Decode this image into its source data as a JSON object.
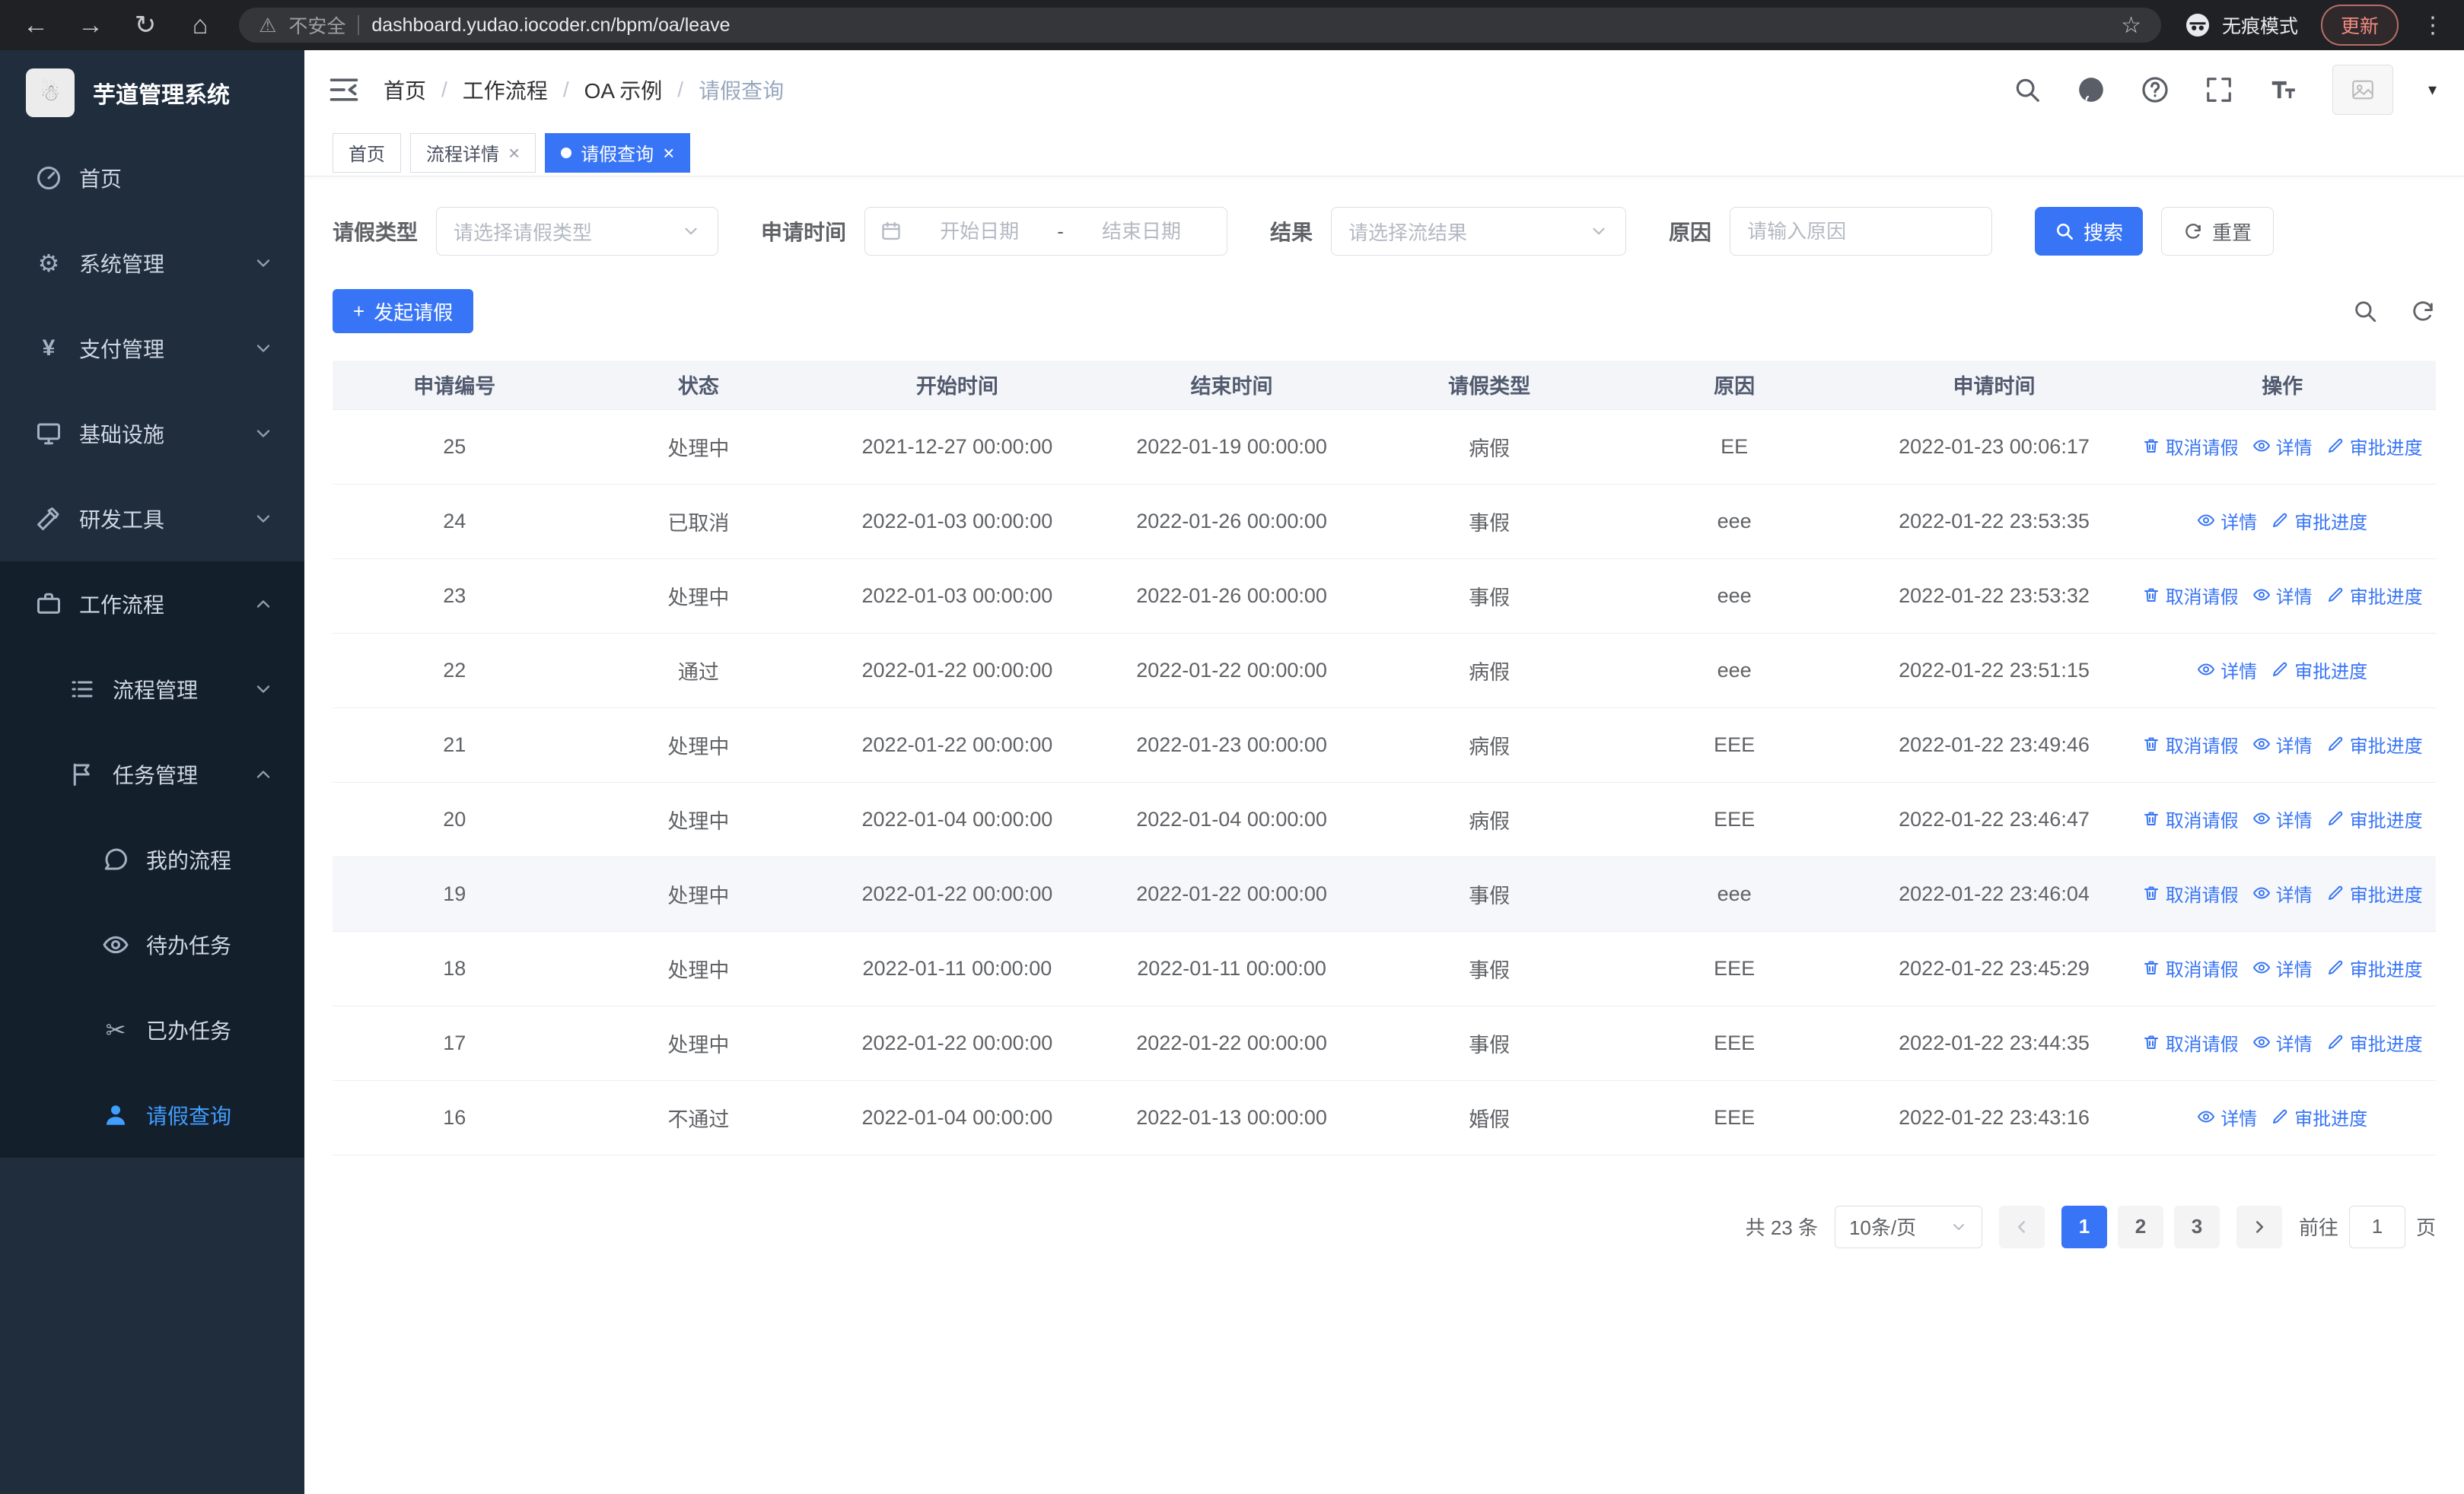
{
  "colors": {
    "accent": "#3875f6",
    "sidebar-bg": "#1f2d3d",
    "submenu-bg": "#141f2c",
    "sidebar-active": "#409eff"
  },
  "browser": {
    "security_label": "不安全",
    "url": "dashboard.yudao.iocoder.cn/bpm/oa/leave",
    "incognito_label": "无痕模式",
    "update_label": "更新"
  },
  "sidebar": {
    "logo_title": "芋道管理系统",
    "items": [
      {
        "icon": "dashboard",
        "label": "首页",
        "level": 1
      },
      {
        "icon": "gear",
        "label": "系统管理",
        "level": 1,
        "chevron": "down"
      },
      {
        "icon": "yen",
        "label": "支付管理",
        "level": 1,
        "chevron": "down"
      },
      {
        "icon": "monitor",
        "label": "基础设施",
        "level": 1,
        "chevron": "down"
      },
      {
        "icon": "hammer",
        "label": "研发工具",
        "level": 1,
        "chevron": "down"
      },
      {
        "icon": "briefcase",
        "label": "工作流程",
        "level": 1,
        "chevron": "up",
        "group": true
      },
      {
        "icon": "list",
        "label": "流程管理",
        "level": 2,
        "chevron": "down",
        "group": true
      },
      {
        "icon": "flag",
        "label": "任务管理",
        "level": 2,
        "chevron": "up",
        "group": true
      },
      {
        "icon": "chat",
        "label": "我的流程",
        "level": 3,
        "group": true
      },
      {
        "icon": "eye",
        "label": "待办任务",
        "level": 3,
        "group": true
      },
      {
        "icon": "scissors",
        "label": "已办任务",
        "level": 3,
        "group": true
      },
      {
        "icon": "person",
        "label": "请假查询",
        "level": 3,
        "group": true,
        "active": true
      }
    ]
  },
  "navbar": {
    "breadcrumb": [
      "首页",
      "工作流程",
      "OA 示例",
      "请假查询"
    ]
  },
  "tabs": [
    {
      "label": "首页",
      "closable": false,
      "active": false
    },
    {
      "label": "流程详情",
      "closable": true,
      "active": false
    },
    {
      "label": "请假查询",
      "closable": true,
      "active": true
    }
  ],
  "filters": {
    "type_label": "请假类型",
    "type_placeholder": "请选择请假类型",
    "time_label": "申请时间",
    "start_placeholder": "开始日期",
    "range_separator": "-",
    "end_placeholder": "结束日期",
    "result_label": "结果",
    "result_placeholder": "请选择流结果",
    "reason_label": "原因",
    "reason_placeholder": "请输入原因",
    "search_label": "搜索",
    "reset_label": "重置"
  },
  "toolbar": {
    "create_label": "发起请假"
  },
  "table": {
    "columns": [
      "申请编号",
      "状态",
      "开始时间",
      "结束时间",
      "请假类型",
      "原因",
      "申请时间",
      "操作"
    ],
    "action_labels": {
      "cancel": "取消请假",
      "detail": "详情",
      "progress": "审批进度"
    },
    "rows": [
      {
        "id": "25",
        "status": "处理中",
        "start": "2021-12-27 00:00:00",
        "end": "2022-01-19 00:00:00",
        "type": "病假",
        "reason": "EE",
        "apply_time": "2022-01-23 00:06:17",
        "actions": [
          "cancel",
          "detail",
          "progress"
        ]
      },
      {
        "id": "24",
        "status": "已取消",
        "start": "2022-01-03 00:00:00",
        "end": "2022-01-26 00:00:00",
        "type": "事假",
        "reason": "eee",
        "apply_time": "2022-01-22 23:53:35",
        "actions": [
          "detail",
          "progress"
        ]
      },
      {
        "id": "23",
        "status": "处理中",
        "start": "2022-01-03 00:00:00",
        "end": "2022-01-26 00:00:00",
        "type": "事假",
        "reason": "eee",
        "apply_time": "2022-01-22 23:53:32",
        "actions": [
          "cancel",
          "detail",
          "progress"
        ]
      },
      {
        "id": "22",
        "status": "通过",
        "start": "2022-01-22 00:00:00",
        "end": "2022-01-22 00:00:00",
        "type": "病假",
        "reason": "eee",
        "apply_time": "2022-01-22 23:51:15",
        "actions": [
          "detail",
          "progress"
        ]
      },
      {
        "id": "21",
        "status": "处理中",
        "start": "2022-01-22 00:00:00",
        "end": "2022-01-23 00:00:00",
        "type": "病假",
        "reason": "EEE",
        "apply_time": "2022-01-22 23:49:46",
        "actions": [
          "cancel",
          "detail",
          "progress"
        ]
      },
      {
        "id": "20",
        "status": "处理中",
        "start": "2022-01-04 00:00:00",
        "end": "2022-01-04 00:00:00",
        "type": "病假",
        "reason": "EEE",
        "apply_time": "2022-01-22 23:46:47",
        "actions": [
          "cancel",
          "detail",
          "progress"
        ]
      },
      {
        "id": "19",
        "status": "处理中",
        "start": "2022-01-22 00:00:00",
        "end": "2022-01-22 00:00:00",
        "type": "事假",
        "reason": "eee",
        "apply_time": "2022-01-22 23:46:04",
        "actions": [
          "cancel",
          "detail",
          "progress"
        ],
        "highlighted": true
      },
      {
        "id": "18",
        "status": "处理中",
        "start": "2022-01-11 00:00:00",
        "end": "2022-01-11 00:00:00",
        "type": "事假",
        "reason": "EEE",
        "apply_time": "2022-01-22 23:45:29",
        "actions": [
          "cancel",
          "detail",
          "progress"
        ]
      },
      {
        "id": "17",
        "status": "处理中",
        "start": "2022-01-22 00:00:00",
        "end": "2022-01-22 00:00:00",
        "type": "事假",
        "reason": "EEE",
        "apply_time": "2022-01-22 23:44:35",
        "actions": [
          "cancel",
          "detail",
          "progress"
        ]
      },
      {
        "id": "16",
        "status": "不通过",
        "start": "2022-01-04 00:00:00",
        "end": "2022-01-13 00:00:00",
        "type": "婚假",
        "reason": "EEE",
        "apply_time": "2022-01-22 23:43:16",
        "actions": [
          "detail",
          "progress"
        ]
      }
    ]
  },
  "pagination": {
    "total_label": "共 23 条",
    "page_size": "10条/页",
    "pages": [
      "1",
      "2",
      "3"
    ],
    "active_page": "1",
    "goto_label": "前往",
    "goto_value": "1",
    "goto_suffix": "页"
  }
}
